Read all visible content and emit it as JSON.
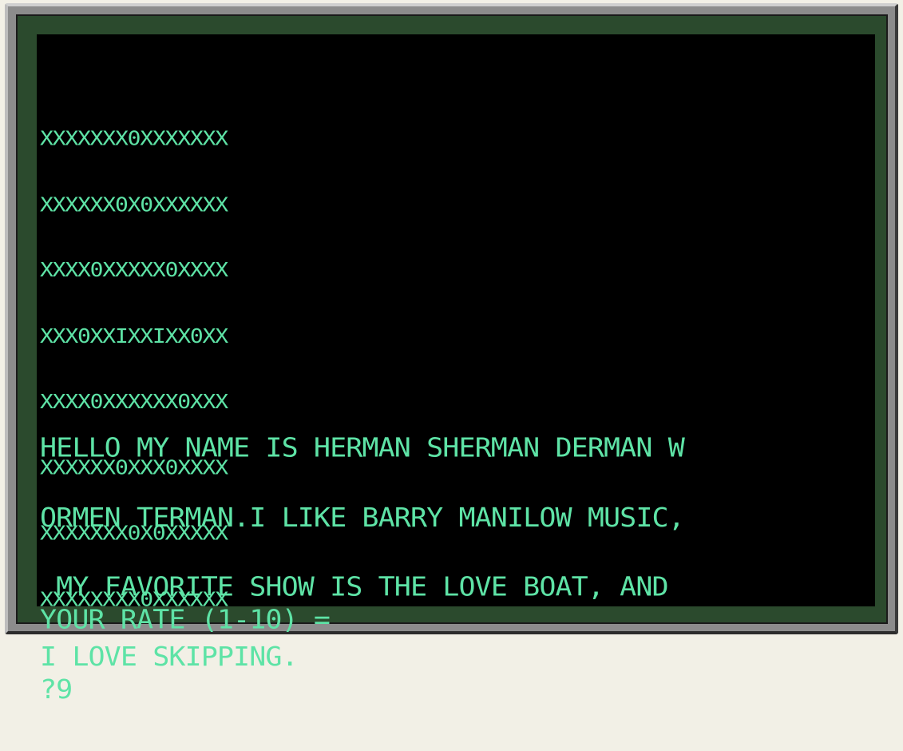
{
  "screen": {
    "art_lines": [
      "XXXXXXX0XXXXXXX",
      "XXXXXX0X0XXXXXX",
      "XXXX0XXXXX0XXXX",
      "XXX0XXIXXIXX0XX",
      "XXXX0XXXXXX0XXX",
      "XXXXXX0XXX0XXXX",
      "XXXXXXX0X0XXXXX",
      "XXXXXXXX0XXXXXX"
    ],
    "message_lines": [
      "HELLO MY NAME IS HERMAN SHERMAN DERMAN W",
      "ORMEN TERMAN.I LIKE BARRY MANILOW MUSIC,",
      " MY FAVORITE SHOW IS THE LOVE BOAT, AND ",
      "I LOVE SKIPPING."
    ],
    "prompt_label": "YOUR RATE (1-10) =",
    "input_line": "?9"
  },
  "colors": {
    "text": "#5ee3a6",
    "screen_bg": "#000000",
    "bezel": "#2b4a2d",
    "frame": "#8c8c8c"
  }
}
